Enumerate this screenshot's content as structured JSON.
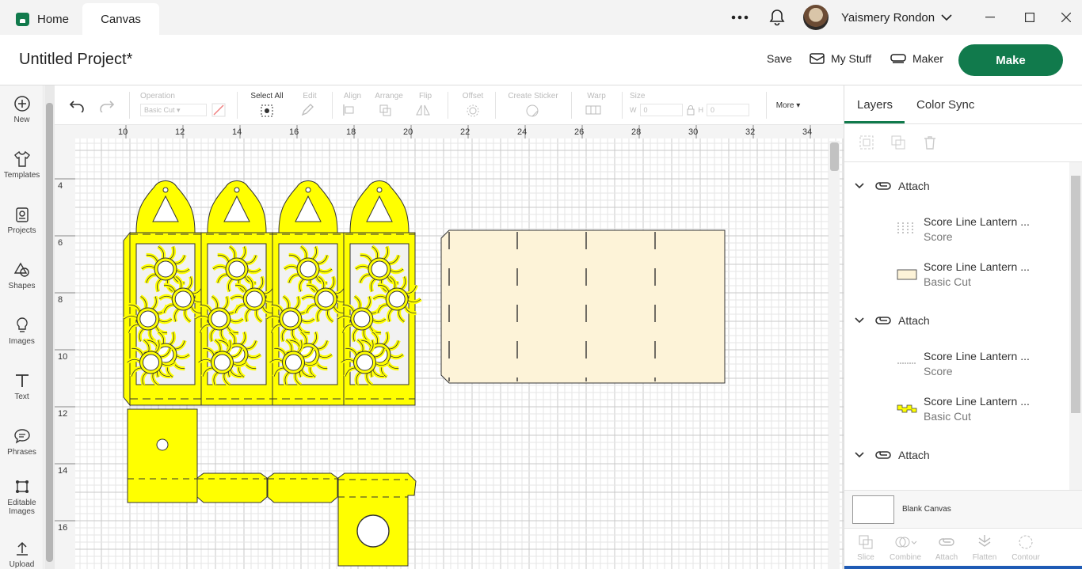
{
  "app": {
    "tabs": [
      {
        "label": "Home"
      },
      {
        "label": "Canvas"
      }
    ],
    "user_name": "Yaismery Rondon"
  },
  "header": {
    "title": "Untitled Project*",
    "save_label": "Save",
    "mystuff_label": "My Stuff",
    "maker_label": "Maker",
    "make_label": "Make"
  },
  "sidebar": {
    "items": [
      {
        "label": "New",
        "icon": "plus-circle-icon"
      },
      {
        "label": "Templates",
        "icon": "shirt-icon"
      },
      {
        "label": "Projects",
        "icon": "projects-icon"
      },
      {
        "label": "Shapes",
        "icon": "shapes-icon"
      },
      {
        "label": "Images",
        "icon": "lightbulb-icon"
      },
      {
        "label": "Text",
        "icon": "text-icon"
      },
      {
        "label": "Phrases",
        "icon": "speech-bubble-icon"
      },
      {
        "label": "Editable Images",
        "icon": "editable-images-icon"
      },
      {
        "label": "Upload",
        "icon": "upload-icon"
      }
    ]
  },
  "toolbar": {
    "operation_label": "Operation",
    "operation_value": "Basic Cut",
    "select_all": "Select All",
    "edit": "Edit",
    "align": "Align",
    "arrange": "Arrange",
    "flip": "Flip",
    "offset": "Offset",
    "create_sticker": "Create Sticker",
    "warp": "Warp",
    "size": "Size",
    "w_label": "W",
    "w_value": "0",
    "h_label": "H",
    "h_value": "0",
    "more": "More"
  },
  "ruler": {
    "x_ticks": [
      "10",
      "12",
      "14",
      "16",
      "18",
      "20",
      "22",
      "24",
      "26",
      "28",
      "30",
      "32",
      "34"
    ],
    "y_ticks": [
      "4",
      "6",
      "8",
      "10",
      "12",
      "14",
      "16"
    ]
  },
  "panel": {
    "tabs": [
      {
        "label": "Layers"
      },
      {
        "label": "Color Sync"
      }
    ],
    "groups": [
      {
        "label": "Attach",
        "layers": [
          {
            "name": "Score Line Lantern ...",
            "type": "Score"
          },
          {
            "name": "Score Line Lantern ...",
            "type": "Basic Cut"
          }
        ]
      },
      {
        "label": "Attach",
        "layers": [
          {
            "name": "Score Line Lantern ...",
            "type": "Score"
          },
          {
            "name": "Score Line Lantern ...",
            "type": "Basic Cut"
          }
        ]
      },
      {
        "label": "Attach",
        "layers": []
      }
    ],
    "blank_canvas": "Blank Canvas",
    "bottom_actions": [
      "Slice",
      "Combine",
      "Attach",
      "Flatten",
      "Contour"
    ]
  },
  "colors": {
    "brand_green": "#117a4c",
    "yellow_material": "#ffff00",
    "cream_material": "#fdf3d8",
    "accent_blue": "#1f5bb5"
  }
}
